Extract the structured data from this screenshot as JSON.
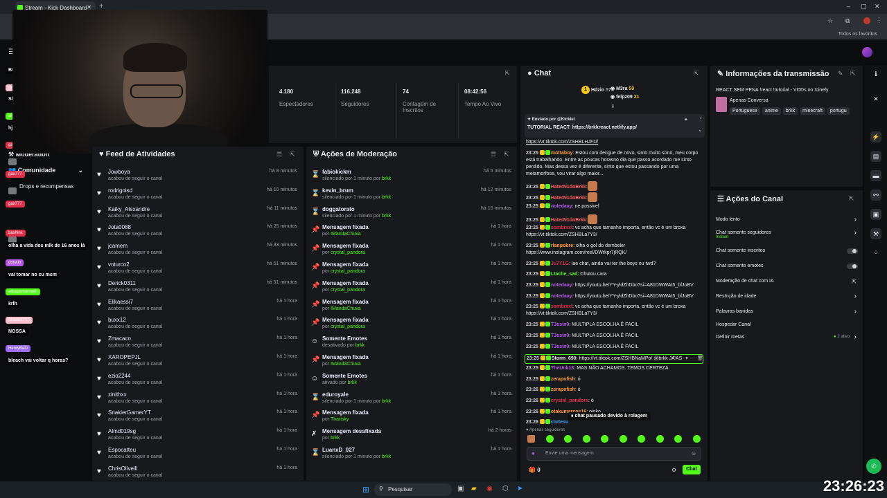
{
  "browser": {
    "tab_title": "Stream - Kick Dashboard",
    "bookmarks_label": "Todos os favoritos"
  },
  "leftnav": {
    "moderation": "Moderation",
    "community": "Comunidade",
    "drops": "Drops e recompensas"
  },
  "overlay_chat": [
    {
      "name": "",
      "msg": "BRASIL E UM MERDA",
      "color": "#7a4dd8"
    },
    {
      "name": "Shade1717",
      "msg": "Slk em",
      "color": "#ffc0cb"
    },
    {
      "name": "unfilled",
      "msg": "hj eu senti a inveja",
      "color": "#53fc18"
    },
    {
      "name": "gax777",
      "msg": "",
      "color": "#e0304c"
    },
    {
      "name": "gax777",
      "msg": "",
      "color": "#e0304c"
    },
    {
      "name": "gax777",
      "msg": "",
      "color": "#e0304c"
    },
    {
      "name": "bashinx",
      "msg": "olha a vida dos mlk de 16 anos lá",
      "color": "#e0304c"
    },
    {
      "name": "doretin",
      "msg": "vai tomar no cu msm",
      "color": "#b45ae8"
    },
    {
      "name": "allcapsmanneth",
      "msg": "krlh",
      "color": "#53fc18"
    },
    {
      "name": "Shade1717",
      "msg": "NOSSA",
      "color": "#ffc0cb"
    },
    {
      "name": "HenryBelb",
      "msg": "bleach vai voltar q horas?",
      "color": "#9a6af0"
    }
  ],
  "stats": [
    {
      "value": "4.180",
      "label": "Espectadores"
    },
    {
      "value": "116.248",
      "label": "Seguidores"
    },
    {
      "value": "74",
      "label": "Contagem de Inscritos"
    },
    {
      "value": "08:42:56",
      "label": "Tempo Ao Vivo"
    }
  ],
  "feed": {
    "title": "Feed de Atividades",
    "items": [
      {
        "name": "Jowboya",
        "sub": "acabou de seguir o canal",
        "time": "há 8 minutos"
      },
      {
        "name": "rodrigoisd",
        "sub": "acabou de seguir o canal",
        "time": "há 10 minutos"
      },
      {
        "name": "Kaiky_Alexandre",
        "sub": "acabou de seguir o canal",
        "time": "há 11 minutos"
      },
      {
        "name": "Jota0088",
        "sub": "acabou de seguir o canal",
        "time": "há 25 minutos"
      },
      {
        "name": "jcamem",
        "sub": "acabou de seguir o canal",
        "time": "há 33 minutos"
      },
      {
        "name": "vnturco2",
        "sub": "acabou de seguir o canal",
        "time": "há 51 minutos"
      },
      {
        "name": "Derick0311",
        "sub": "acabou de seguir o canal",
        "time": "há 51 minutos"
      },
      {
        "name": "Elikaessi7",
        "sub": "acabou de seguir o canal",
        "time": "há 1 hora"
      },
      {
        "name": "buxx12",
        "sub": "acabou de seguir o canal",
        "time": "há 1 hora"
      },
      {
        "name": "Zmacaco",
        "sub": "acabou de seguir o canal",
        "time": "há 1 hora"
      },
      {
        "name": "XAROPEPJL",
        "sub": "acabou de seguir o canal",
        "time": "há 1 hora"
      },
      {
        "name": "ezio2244",
        "sub": "acabou de seguir o canal",
        "time": "há 1 hora"
      },
      {
        "name": "zinithxx",
        "sub": "acabou de seguir o canal",
        "time": "há 1 hora"
      },
      {
        "name": "SnakierGamerYT",
        "sub": "acabou de seguir o canal",
        "time": "há 1 hora"
      },
      {
        "name": "Almd019sg",
        "sub": "acabou de seguir o canal",
        "time": "há 1 hora"
      },
      {
        "name": "Espocatteu",
        "sub": "acabou de seguir o canal",
        "time": "há 1 hora"
      },
      {
        "name": "ChrisOliveill",
        "sub": "acabou de seguir o canal",
        "time": "há 1 hora"
      }
    ]
  },
  "modactions": {
    "title": "Ações de Moderação",
    "items": [
      {
        "icon": "⌛",
        "name": "fabiokickm",
        "sub": "silenciado por 1 minuto por ",
        "by": "brkk",
        "time": "há 5 minutos"
      },
      {
        "icon": "⌛",
        "name": "kevin_brum",
        "sub": "silenciado por 1 minuto por ",
        "by": "brkk",
        "time": "há 12 minutos"
      },
      {
        "icon": "⌛",
        "name": "doggatorato",
        "sub": "silenciado por 1 minuto por ",
        "by": "brkk",
        "time": "há 15 minutos"
      },
      {
        "icon": "📌",
        "name": "Mensagem fixada",
        "sub": "por ",
        "by": "IMandaChuva",
        "time": "há 1 hora"
      },
      {
        "icon": "📌",
        "name": "Mensagem fixada",
        "sub": "por ",
        "by": "crystal_pandora",
        "time": "há 1 hora"
      },
      {
        "icon": "📌",
        "name": "Mensagem fixada",
        "sub": "por ",
        "by": "crystal_pandora",
        "time": "há 1 hora"
      },
      {
        "icon": "📌",
        "name": "Mensagem fixada",
        "sub": "por ",
        "by": "crystal_pandora",
        "time": "há 1 hora"
      },
      {
        "icon": "📌",
        "name": "Mensagem fixada",
        "sub": "por ",
        "by": "IMandaChuva",
        "time": "há 1 hora"
      },
      {
        "icon": "📌",
        "name": "Mensagem fixada",
        "sub": "por ",
        "by": "crystal_pandora",
        "time": "há 1 hora"
      },
      {
        "icon": "☺",
        "name": "Somente Emotes",
        "sub": "desativado por ",
        "by": "brkk",
        "time": "há 1 hora"
      },
      {
        "icon": "📌",
        "name": "Mensagem fixada",
        "sub": "por ",
        "by": "IMandaChuva",
        "time": "há 1 hora"
      },
      {
        "icon": "☺",
        "name": "Somente Emotes",
        "sub": "ativado por ",
        "by": "brkk",
        "time": "há 1 hora"
      },
      {
        "icon": "⌛",
        "name": "eduroyale",
        "sub": "silenciado por 1 minuto por ",
        "by": "brkk",
        "time": "há 1 hora"
      },
      {
        "icon": "📌",
        "name": "Mensagem fixada",
        "sub": "por ",
        "by": "Tharisky",
        "time": "há 1 hora"
      },
      {
        "icon": "✗",
        "name": "Mensagem desafixada",
        "sub": "por ",
        "by": "brkk",
        "time": "há 2 horas"
      },
      {
        "icon": "⌛",
        "name": "LuanxD_027",
        "sub": "silenciado por 1 minuto por ",
        "by": "brkk",
        "time": "há 1 hora"
      }
    ]
  },
  "chat": {
    "title": "Chat",
    "top": [
      {
        "rank": "1",
        "name": "Hdzin",
        "count": "57"
      },
      {
        "name": "M3ra",
        "count": "50"
      },
      {
        "name": "felpz09",
        "count": "21"
      }
    ],
    "pinned": {
      "sent_by_label": "Enviado por",
      "sender": "@Kicklet",
      "text": "TUTORIAL REACT:",
      "link": "https://brkkreact.netlify.app/"
    },
    "lines": [
      {
        "time": "",
        "user": "",
        "msg": "https://vt.tiktok.com/ZSHBLHJFD/",
        "link": true,
        "color": "#fff"
      },
      {
        "time": "23:25",
        "user": "mottaboy",
        "msg": ": Estou com dengue de novo, sinto muito sono, meu corpo está trabalhando. Entre as poucas horasno dia que passo acordado me sinto perdido. Mas dessa vez é diferente, sinto que estou passando por uma metamorfose, vou virar algo maior...",
        "color": "#ff9f2e",
        "tall": 4
      },
      {
        "time": "23:25",
        "user": "HaterN1doBrkk",
        "msg": ":",
        "color": "#ff5a5a",
        "emote": true
      },
      {
        "time": "23:25",
        "user": "HaterN1doBrkk",
        "msg": ":",
        "color": "#ff5a5a",
        "emote": true
      },
      {
        "time": "23:25",
        "user": "notedaay",
        "msg": ": ne possivel",
        "color": "#b45ae8"
      },
      {
        "time": "23:25",
        "user": "HaterN1doBrkk",
        "msg": ":",
        "color": "#ff5a5a",
        "emote": true
      },
      {
        "time": "23:25",
        "user": "sombrxxl",
        "msg": ": vc acha que tamanho importa, então vc é um broxa https://vt.tiktok.com/ZSHBLa7Y3/",
        "color": "#e0304c",
        "tall": 2
      },
      {
        "time": "23:25",
        "user": "rlanpobre",
        "msg": ": olha o gol do dembeler https://www.instagram.com/reel/DWrkpr7jRQK/",
        "color": "#ff9f2e",
        "tall": 2
      },
      {
        "time": "23:25",
        "user": "Ju7Y1G",
        "msg": ": lae chat, ainda vai ter the boys ou twd?",
        "color": "#e0304c"
      },
      {
        "time": "23:25",
        "user": "Ltache_sad",
        "msg": ": Chutou cara",
        "color": "#53fc18"
      },
      {
        "time": "23:25",
        "user": "notedaay",
        "msg": ": https://youtu.be/YY-yldZhDbo?si=A81DWWAt5_bfJoBV",
        "color": "#b45ae8"
      },
      {
        "time": "23:25",
        "user": "notedaay",
        "msg": ": https://youtu.be/YY-yldZhDbo?si=A81DWWAt5_bfJoBV",
        "color": "#b45ae8"
      },
      {
        "time": "23:25",
        "user": "sombrxxl",
        "msg": ": vc acha que tamanho importa, então vc é um broxa https://vt.tiktok.com/ZSHBLa7Y3/",
        "color": "#e0304c",
        "tall": 2
      },
      {
        "time": "23:25",
        "user": "TJosin0",
        "msg": ": MULTIPLA ESCOLHA É FACIL",
        "color": "#b45ae8"
      },
      {
        "time": "23:25",
        "user": "TJosin0",
        "msg": ": MULTIPLA ESCOLHA É FACIL",
        "color": "#b45ae8"
      },
      {
        "time": "23:25",
        "user": "TJosin0",
        "msg": ": MULTIPLA ESCOLHA É FACIL",
        "color": "#b45ae8"
      },
      {
        "time": "23:25",
        "user": "Storm_690",
        "msg": ": https://vt.tiktok.com/ZSHBNaMPo/ @brkk JA AS",
        "color": "#e9ecef",
        "hl": true
      },
      {
        "time": "23:25",
        "user": "TheUnk13",
        "msg": ": MAS NÃO ACHAMOS. TEMOS CERTEZA",
        "color": "#b45ae8"
      },
      {
        "time": "23:25",
        "user": "zerapofish",
        "msg": ": ó",
        "color": "#ff9f2e"
      },
      {
        "time": "23:26",
        "user": "zerapofish",
        "msg": ": ó",
        "color": "#ff9f2e"
      },
      {
        "time": "23:26",
        "user": "crystal_pandora",
        "msg": ": ó",
        "color": "#e0304c"
      },
      {
        "time": "23:26",
        "user": "otakumarcos16",
        "msg": ": oioko",
        "color": "#ff9f2e"
      },
      {
        "time": "23:26",
        "user": "cortesu",
        "msg": "",
        "color": "#3aa0ff"
      }
    ],
    "paused": "chat pausado devido à rolagem",
    "followers_only": "Apenas seguidores",
    "input_placeholder": "Envie uma mensagem",
    "send_label": "Chat",
    "counter": "0"
  },
  "stream_info": {
    "title": "Informações da transmissão",
    "stream_title": "REACT SEM PENA !react !tutorial - VODs no !cinefy",
    "category": "Apenas Conversa",
    "tags": [
      "Portuguese",
      "anime",
      "brkk",
      "minecraft",
      "portugu"
    ]
  },
  "channel_actions": {
    "title": "Ações do Canal",
    "rows": [
      {
        "label": "Modo lento",
        "type": "chevron"
      },
      {
        "label": "Chat somente seguidores",
        "sub": "Instant",
        "type": "chevron"
      },
      {
        "label": "Chat somente inscritos",
        "type": "toggle"
      },
      {
        "label": "Chat somente emotes",
        "type": "toggle"
      },
      {
        "label": "Moderação de chat com IA",
        "type": "external"
      },
      {
        "label": "Restrição de idade",
        "type": "chevron"
      },
      {
        "label": "Palavras banidas",
        "type": "chevron"
      },
      {
        "label": "Hospedar Canal",
        "type": "none"
      },
      {
        "label": "Definir metas",
        "badge": "2 ativo",
        "type": "chevron"
      }
    ]
  },
  "taskbar": {
    "search": "Pesquisar"
  },
  "clock": "23:26:23",
  "colors": {
    "accent": "#53fc18",
    "panel": "#17191c",
    "background": "#0b0d0f"
  }
}
